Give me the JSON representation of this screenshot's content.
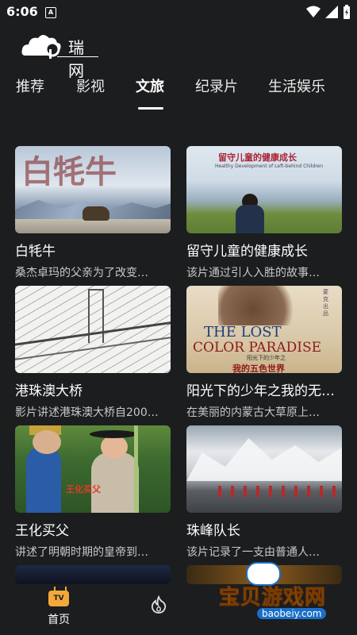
{
  "status_bar": {
    "time": "6:06",
    "indicator": "A"
  },
  "logo": {
    "text": "瑞网"
  },
  "tabs": [
    {
      "label": "推荐"
    },
    {
      "label": "影视"
    },
    {
      "label": "文旅"
    },
    {
      "label": "纪录片"
    },
    {
      "label": "生活娱乐"
    }
  ],
  "active_tab": "文旅",
  "cards": [
    {
      "title": "白牦牛",
      "desc": "桑杰卓玛的父亲为了改变…",
      "thumb_text": "白牦牛"
    },
    {
      "title": "留守儿童的健康成长",
      "desc": "该片通过引人入胜的故事…",
      "thumb_title": "留守儿童的健康成长",
      "thumb_sub": "Healthy Development of Left-behind Children"
    },
    {
      "title": "港珠澳大桥",
      "desc": "影片讲述港珠澳大桥自200…"
    },
    {
      "title": "阳光下的少年之我的无…",
      "desc": "在美丽的内蒙古大草原上…",
      "poster_line1": "THE LOST",
      "poster_line2": "COLOR PARADISE",
      "poster_cn_small": "阳光下的少年之",
      "poster_cn": "我的五色世界",
      "poster_side": "蒙克出品"
    },
    {
      "title": "王化买父",
      "desc": "讲述了明朝时期的皇帝到…",
      "thumb_text": "王化买父"
    },
    {
      "title": "珠峰队长",
      "desc": "该片记录了一支由普通人…"
    }
  ],
  "bottom_nav": {
    "home_label": "首页",
    "tv_badge": "TV"
  },
  "watermark": {
    "text": "宝贝游戏网",
    "url": "baobeiy.com"
  },
  "colors": {
    "background": "#1c1d1f",
    "accent": "#f2a83b",
    "text": "#ffffff",
    "muted": "#c8c8c8"
  }
}
